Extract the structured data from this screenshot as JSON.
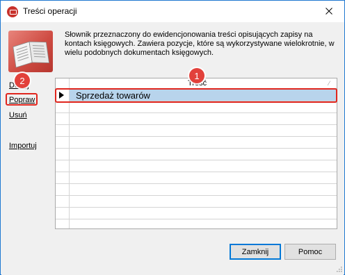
{
  "window": {
    "title": "Treści operacji",
    "icon": "app-logo-icon",
    "close_icon": "close-icon"
  },
  "header": {
    "description": "Słownik przeznaczony do ewidencjonowania treści opisujących zapisy na kontach księgowych. Zawiera pozycje, które są wykorzystywane wielokrotnie, w wielu podobnych dokumentach księgowych.",
    "icon": "book-icon"
  },
  "sidebar": {
    "items": [
      {
        "label": "Dodaj"
      },
      {
        "label": "Popraw"
      },
      {
        "label": "Usuń"
      },
      {
        "label": "Importuj"
      }
    ]
  },
  "grid": {
    "column_header": "Treść",
    "rows": [
      {
        "text": "Sprzedaż towarów",
        "selected": true
      },
      {
        "text": ""
      },
      {
        "text": ""
      },
      {
        "text": ""
      },
      {
        "text": ""
      },
      {
        "text": ""
      },
      {
        "text": ""
      },
      {
        "text": ""
      },
      {
        "text": ""
      },
      {
        "text": ""
      },
      {
        "text": ""
      },
      {
        "text": ""
      }
    ]
  },
  "annotations": {
    "badge_1": "1",
    "badge_2": "2",
    "accent": "#e0251d"
  },
  "buttons": {
    "close_label": "Zamknij",
    "help_label": "Pomoc"
  }
}
